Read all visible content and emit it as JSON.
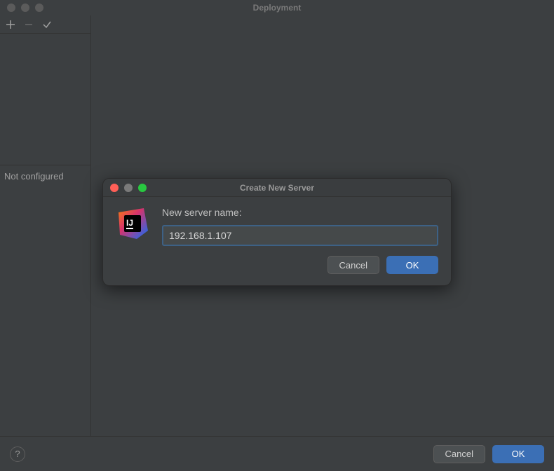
{
  "parent": {
    "title": "Deployment",
    "left_status": "Not configured",
    "footer": {
      "cancel": "Cancel",
      "ok": "OK",
      "help": "?"
    }
  },
  "modal": {
    "title": "Create New Server",
    "label": "New server name:",
    "value": "192.168.1.107",
    "icon_text": "IJ",
    "cancel": "Cancel",
    "ok": "OK"
  }
}
